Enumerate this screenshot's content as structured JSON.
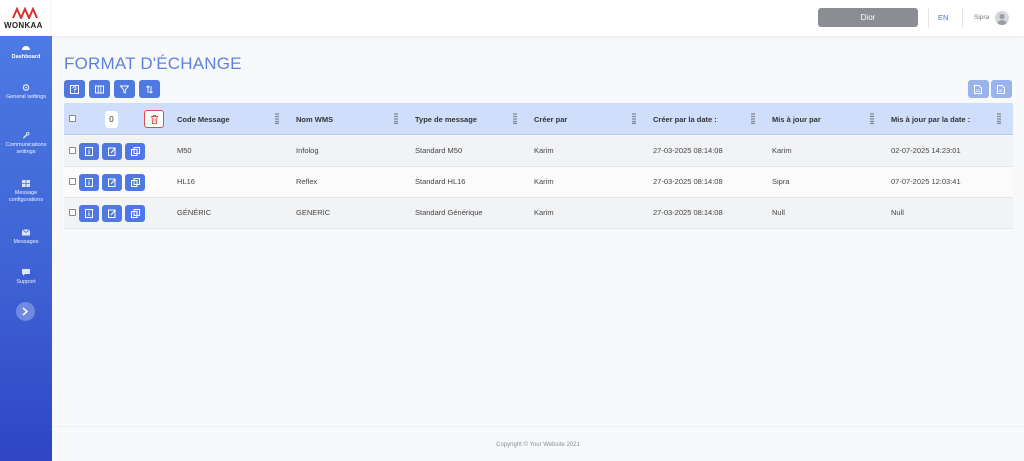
{
  "brand": {
    "name": "WONKAA"
  },
  "sidebar": {
    "items": [
      {
        "label": "Dashboard",
        "icon": "dashboard-icon",
        "active": true
      },
      {
        "label": "General settings",
        "icon": "gear-icon",
        "active": false
      },
      {
        "label": "Communications settings",
        "icon": "wrench-icon",
        "active": false
      },
      {
        "label": "Message configurations",
        "icon": "grid-icon",
        "active": false
      },
      {
        "label": "Messages",
        "icon": "envelope-icon",
        "active": false
      },
      {
        "label": "Support",
        "icon": "chat-icon",
        "active": false
      }
    ],
    "toggle_icon": "chevron-right-icon"
  },
  "header": {
    "client_button": "Dior",
    "language": "EN",
    "user_name": "Sipra"
  },
  "page": {
    "title": "FORMAT D'ÉCHANGE"
  },
  "toolbar": {
    "buttons": [
      "help-icon",
      "columns-icon",
      "filter-icon",
      "sort-icon"
    ],
    "export_buttons": [
      "export-file-icon",
      "export-pdf-icon"
    ]
  },
  "table": {
    "selected_count": "0",
    "headers": [
      "Code Message",
      "Nom WMS",
      "Type de message",
      "Créer par",
      "Créer par la date :",
      "Mis à jour par",
      "Mis à jour par la date :"
    ],
    "rows": [
      [
        "M50",
        "Infolog",
        "Standard M50",
        "Karim",
        "27-03-2025 08:14:08",
        "Karim",
        "02-07-2025 14:23:01"
      ],
      [
        "HL16",
        "Reflex",
        "Standard HL16",
        "Karim",
        "27-03-2025 08:14:08",
        "Sipra",
        "07-07-2025 12:03:41"
      ],
      [
        "GÉNÉRIC",
        "GENERIC",
        "Standard Générique",
        "Karim",
        "27-03-2025 08:14:08",
        "Null",
        "Null"
      ]
    ]
  },
  "footer": {
    "text": "Copyright © Your Website 2021"
  },
  "colors": {
    "accent": "#4f78e0",
    "sidebar": "#3e62d4",
    "title": "#5d82dd",
    "header_row": "#cfdefb",
    "danger": "#e04b4b"
  }
}
